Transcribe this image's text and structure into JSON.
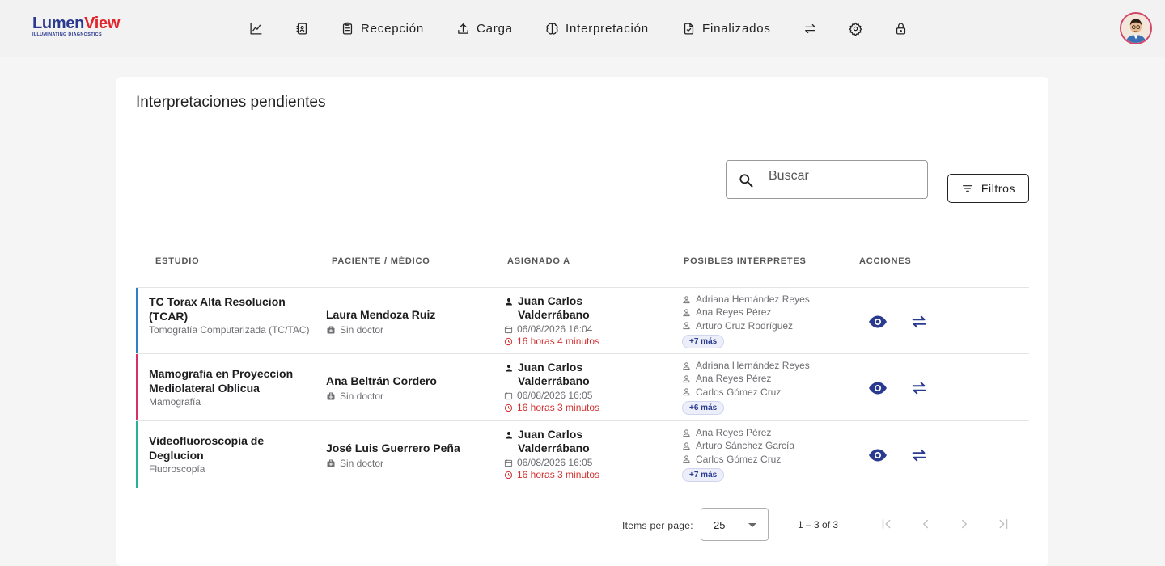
{
  "brand": {
    "name_part1": "Lumen",
    "name_part2": "View",
    "tagline": "ILLUMINATING DIAGNOSTICS"
  },
  "nav": {
    "dashboard_icon": "chart-line-icon",
    "worklist_icon": "contacts-book-icon",
    "items": [
      {
        "label": "Recepción",
        "icon": "clipboard-icon"
      },
      {
        "label": "Carga",
        "icon": "upload-icon"
      },
      {
        "label": "Interpretación",
        "icon": "brain-icon"
      },
      {
        "label": "Finalizados",
        "icon": "file-check-icon"
      }
    ],
    "extra_icons": [
      "swap-arrows-icon",
      "gear-icon",
      "lock-icon"
    ],
    "avatar": "user-avatar"
  },
  "page": {
    "title": "Interpretaciones pendientes",
    "search_placeholder": "Buscar",
    "filter_label": "Filtros"
  },
  "table": {
    "headers": [
      "ESTUDIO",
      "PACIENTE / MÉDICO",
      "ASIGNADO A",
      "POSIBLES INTÉRPRETES",
      "ACCIONES"
    ],
    "rows": [
      {
        "accent": "#2f7fc1",
        "study": "TC Torax Alta Resolucion (TCAR)",
        "modality": "Tomografía Computarizada (TC/TAC)",
        "patient": "Laura Mendoza Ruiz",
        "doctor": "Sin doctor",
        "assigned": "Juan Carlos Valderrábano",
        "date": "06/08/2026 16:04",
        "elapsed": "16 horas 4 minutos",
        "interpreters": [
          "Adriana Hernández Reyes",
          "Ana Reyes Pérez",
          "Arturo Cruz Rodríguez"
        ],
        "more": "+7 más"
      },
      {
        "accent": "#d62f6a",
        "study": "Mamografia en Proyeccion Mediolateral Oblicua",
        "modality": "Mamografía",
        "patient": "Ana Beltrán Cordero",
        "doctor": "Sin doctor",
        "assigned": "Juan Carlos Valderrábano",
        "date": "06/08/2026 16:05",
        "elapsed": "16 horas 3 minutos",
        "interpreters": [
          "Adriana Hernández Reyes",
          "Ana Reyes Pérez",
          "Carlos Gómez Cruz"
        ],
        "more": "+6 más"
      },
      {
        "accent": "#22b39a",
        "study": "Videofluoroscopia de Deglucion",
        "modality": "Fluoroscopía",
        "patient": "José Luis Guerrero Peña",
        "doctor": "Sin doctor",
        "assigned": "Juan Carlos Valderrábano",
        "date": "06/08/2026 16:05",
        "elapsed": "16 horas 3 minutos",
        "interpreters": [
          "Ana Reyes Pérez",
          "Arturo Sánchez García",
          "Carlos Gómez Cruz"
        ],
        "more": "+7 más"
      }
    ]
  },
  "paginator": {
    "items_per_page_label": "Items per page:",
    "page_size": "25",
    "range": "1 – 3 of 3"
  },
  "colors": {
    "accent_blue": "#2a3a8f",
    "brand_red": "#e3242b",
    "overdue_red": "#d3302f"
  }
}
